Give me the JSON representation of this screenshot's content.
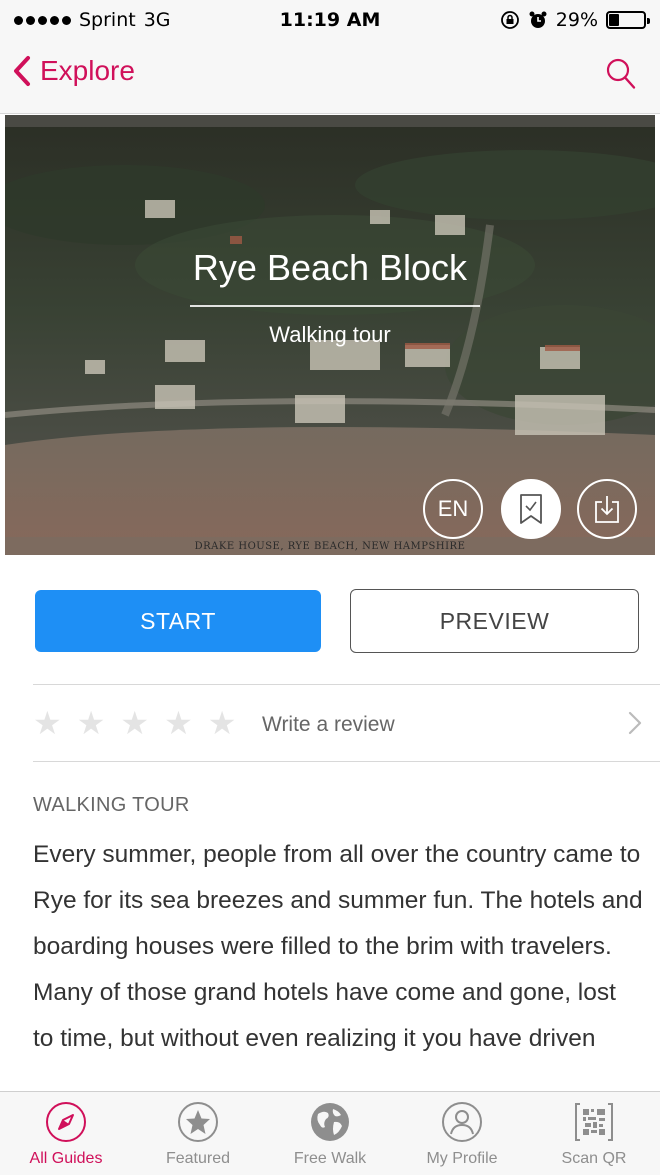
{
  "status_bar": {
    "carrier": "Sprint",
    "network": "3G",
    "time": "11:19 AM",
    "battery_percent": "29%",
    "battery_level": 0.29
  },
  "nav": {
    "back_label": "Explore",
    "accent_color": "#d0105a"
  },
  "tour": {
    "title": "Rye Beach Block",
    "subtitle": "Walking tour",
    "image_caption": "DRAKE HOUSE, RYE BEACH, NEW HAMPSHIRE",
    "language": "EN"
  },
  "actions": {
    "start_label": "START",
    "preview_label": "PREVIEW",
    "start_color": "#1e8ff5"
  },
  "review": {
    "rating": 0,
    "max_rating": 5,
    "label": "Write a review"
  },
  "description": {
    "section_label": "WALKING TOUR",
    "text": "Every summer, people from all over the country came to Rye for its sea breezes and summer fun. The hotels and boarding houses were filled to the brim with travelers. Many of those grand hotels have come and gone, lost to time, but without even realizing it you have driven past those quiet"
  },
  "tab_bar": {
    "tabs": [
      {
        "label": "All Guides",
        "icon": "compass-icon",
        "active": true
      },
      {
        "label": "Featured",
        "icon": "star-icon",
        "active": false
      },
      {
        "label": "Free Walk",
        "icon": "globe-icon",
        "active": false
      },
      {
        "label": "My Profile",
        "icon": "profile-icon",
        "active": false
      },
      {
        "label": "Scan QR",
        "icon": "qr-code-icon",
        "active": false
      }
    ]
  }
}
